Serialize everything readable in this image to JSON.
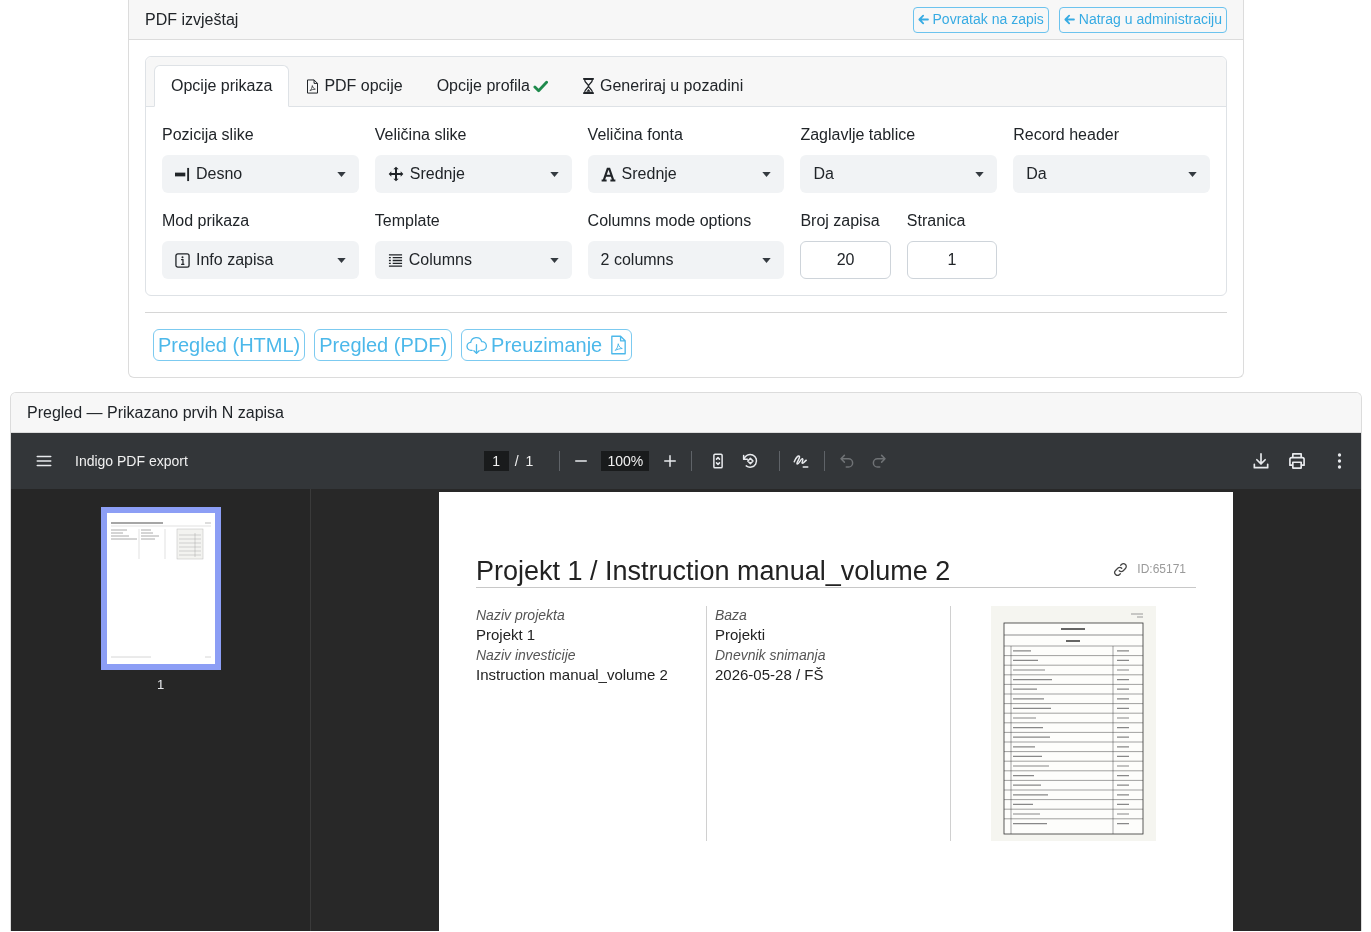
{
  "report": {
    "title": "PDF izvještaj",
    "header_buttons": [
      {
        "label": "Povratak na zapis"
      },
      {
        "label": "Natrag u administraciju"
      }
    ],
    "tabs": [
      {
        "label": "Opcije prikaza",
        "selected": true
      },
      {
        "label": "PDF opcije",
        "selected": false
      },
      {
        "label": "Opcije profila",
        "selected": false
      },
      {
        "label": "Generiraj u pozadini",
        "selected": false
      }
    ],
    "fields": [
      {
        "kind": "select",
        "label": "Pozicija slike",
        "value": "Desno"
      },
      {
        "kind": "select",
        "label": "Veličina slike",
        "value": "Srednje"
      },
      {
        "kind": "select",
        "label": "Veličina fonta",
        "value": "Srednje"
      },
      {
        "kind": "select",
        "label": "Zaglavlje tablice",
        "value": "Da"
      },
      {
        "kind": "select",
        "label": "Record header",
        "value": "Da"
      },
      {
        "kind": "select",
        "label": "Mod prikaza",
        "value": "Info zapisa"
      },
      {
        "kind": "select",
        "label": "Template",
        "value": "Columns"
      },
      {
        "kind": "select",
        "label": "Columns mode options",
        "value": "2 columns"
      },
      {
        "kind": "number",
        "label": "Broj zapisa",
        "value": "20"
      },
      {
        "kind": "number",
        "label": "Stranica",
        "value": "1"
      }
    ],
    "actions": [
      {
        "label": "Pregled (HTML)"
      },
      {
        "label": "Pregled (PDF)"
      },
      {
        "label": "Preuzimanje"
      }
    ]
  },
  "preview": {
    "title": "Pregled — Prikazano prvih N zapisa",
    "viewer": {
      "document_title": "Indigo PDF export",
      "page_input": "1",
      "page_separator": "/",
      "page_count": "1",
      "zoom": "100%",
      "undo": {
        "disabled": true
      },
      "redo": {
        "disabled": true
      },
      "thumbnails": [
        {
          "label": "1",
          "selected": true
        }
      ],
      "page": {
        "title": "Projekt 1 / Instruction manual_volume 2",
        "record_id": "ID:65171",
        "columns": [
          {
            "fields": [
              {
                "label": "Naziv projekta",
                "value": "Projekt 1"
              },
              {
                "label": "Naziv investicije",
                "value": "Instruction manual_volume 2"
              }
            ]
          },
          {
            "fields": [
              {
                "label": "Baza",
                "value": "Projekti"
              },
              {
                "label": "Dnevnik snimanja",
                "value": "2026-05-28 / FŠ"
              }
            ]
          }
        ]
      }
    }
  }
}
